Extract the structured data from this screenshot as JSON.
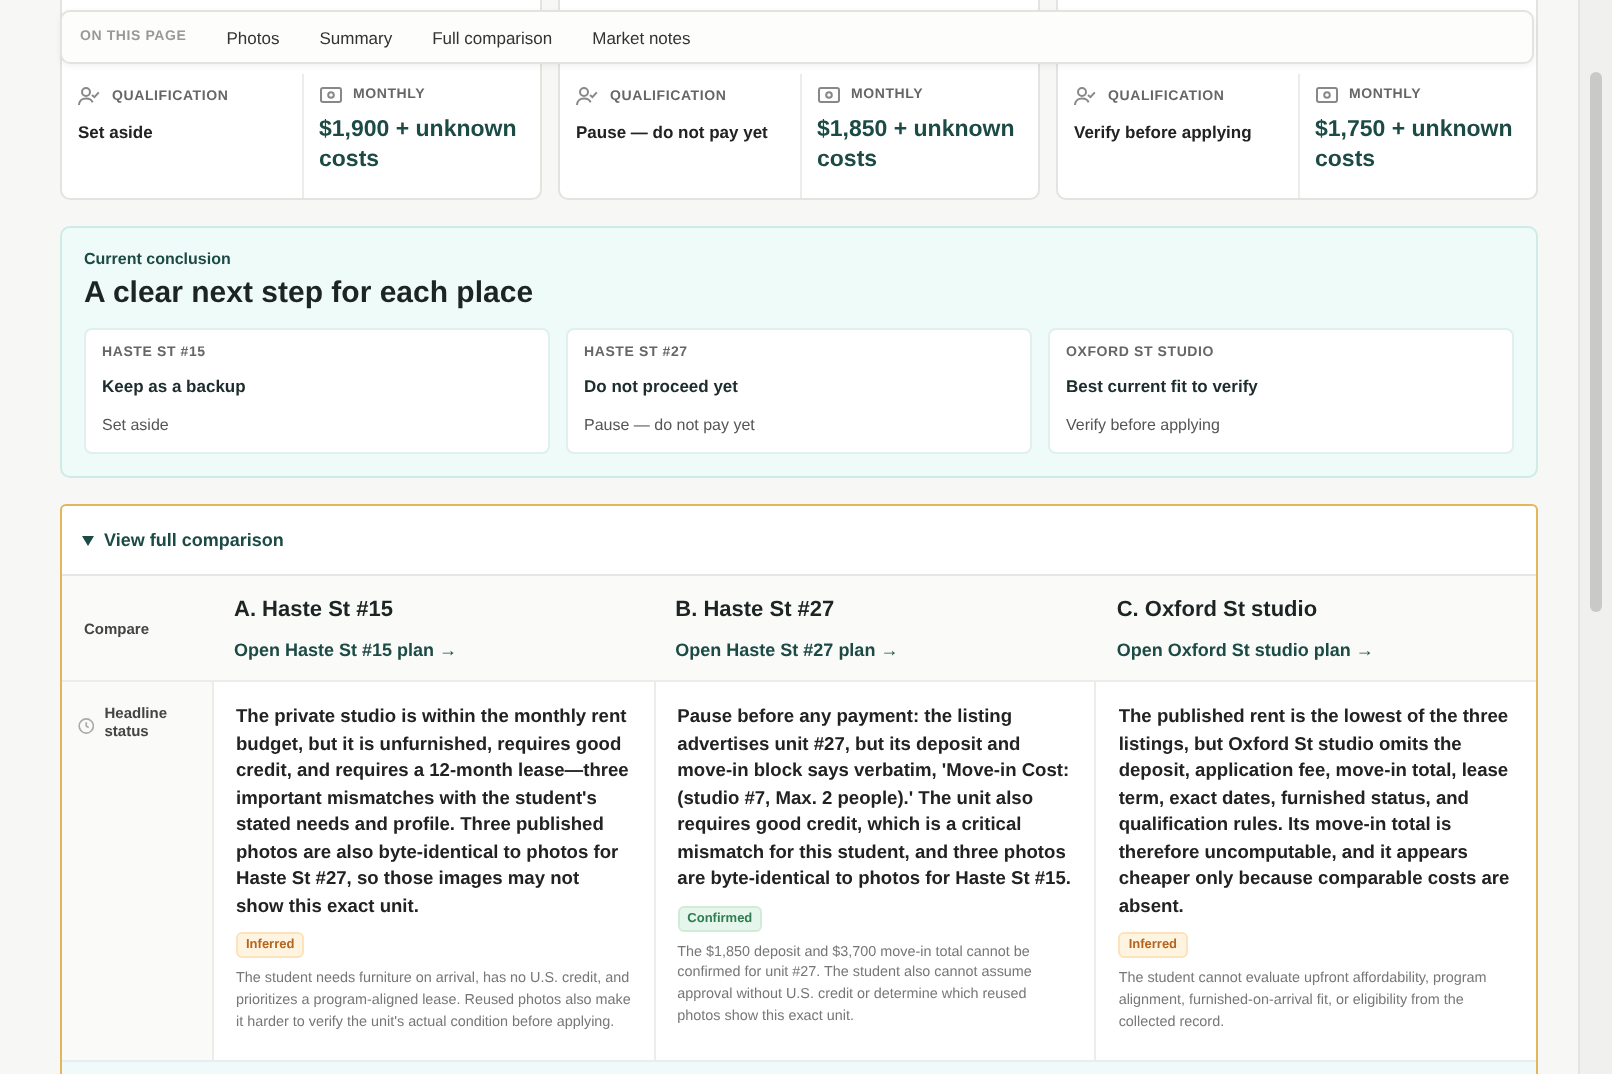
{
  "nav": {
    "label": "ON THIS PAGE",
    "links": [
      {
        "label": "Photos"
      },
      {
        "label": "Summary"
      },
      {
        "label": "Full comparison"
      },
      {
        "label": "Market notes"
      }
    ]
  },
  "places": [
    {
      "qualification_label": "QUALIFICATION",
      "qualification": "Set aside",
      "monthly_label": "MONTHLY",
      "monthly": "$1,900 + unknown costs"
    },
    {
      "qualification_label": "QUALIFICATION",
      "qualification": "Pause — do not pay yet",
      "monthly_label": "MONTHLY",
      "monthly": "$1,850 + unknown costs"
    },
    {
      "qualification_label": "QUALIFICATION",
      "qualification": "Verify before applying",
      "monthly_label": "MONTHLY",
      "monthly": "$1,750 + unknown costs"
    }
  ],
  "conclusion": {
    "eyebrow": "Current conclusion",
    "title": "A clear next step for each place",
    "cards": [
      {
        "place": "HASTE ST #15",
        "step": "Keep as a backup",
        "note": "Set aside"
      },
      {
        "place": "HASTE ST #27",
        "step": "Do not proceed yet",
        "note": "Pause — do not pay yet"
      },
      {
        "place": "OXFORD ST STUDIO",
        "step": "Best current fit to verify",
        "note": "Verify before applying"
      }
    ]
  },
  "comparison": {
    "toggle": "View full comparison",
    "expanded": true,
    "compare_label": "Compare",
    "columns": [
      {
        "title": "A. Haste St #15",
        "link": "Open Haste St #15 plan →"
      },
      {
        "title": "B. Haste St #27",
        "link": "Open Haste St #27 plan →"
      },
      {
        "title": "C. Oxford St studio",
        "link": "Open Oxford St studio plan →"
      }
    ],
    "rows": [
      {
        "label": "Headline status",
        "cells": [
          {
            "text": "The private studio is within the monthly rent budget, but it is unfurnished, requires good credit, and requires a 12-month lease—three important mismatches with the student's stated needs and profile. Three published photos are also byte-identical to photos for Haste St #27, so those images may not show this exact unit.",
            "badge": {
              "label": "Inferred",
              "kind": "inferred"
            },
            "detail": "The student needs furniture on arrival, has no U.S. credit, and prioritizes a program-aligned lease. Reused photos also make it harder to verify the unit's actual condition before applying."
          },
          {
            "text": "Pause before any payment: the listing advertises unit #27, but its deposit and move-in block says verbatim, 'Move-in Cost: (studio #7, Max. 2 people).' The unit also requires good credit, which is a critical mismatch for this student, and three photos are byte-identical to photos for Haste St #15.",
            "badge": {
              "label": "Confirmed",
              "kind": "confirmed"
            },
            "detail": "The $1,850 deposit and $3,700 move-in total cannot be confirmed for unit #27. The student also cannot assume approval without U.S. credit or determine which reused photos show this exact unit."
          },
          {
            "text": "The published rent is the lowest of the three listings, but Oxford St studio omits the deposit, application fee, move-in total, lease term, exact dates, furnished status, and qualification rules. Its move-in total is therefore uncomputable, and it appears cheaper only because comparable costs are absent.",
            "badge": {
              "label": "Inferred",
              "kind": "inferred"
            },
            "detail": "The student cannot evaluate upfront affordability, program alignment, furnished-on-arrival fit, or eligibility from the collected record."
          }
        ]
      }
    ]
  }
}
